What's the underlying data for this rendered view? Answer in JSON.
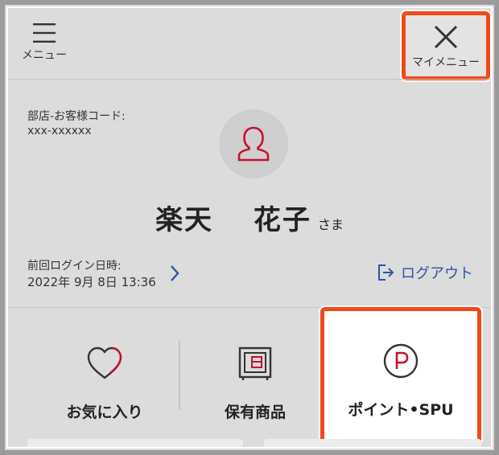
{
  "header": {
    "menu_label": "メニュー",
    "mymenu_label": "マイメニュー"
  },
  "member": {
    "code_label": "部店-お客様コード:",
    "code_value": "xxx-xxxxxx",
    "name": "楽天　 花子",
    "honorific": "さま",
    "last_login_label": "前回ログイン日時:",
    "last_login_value": "2022年 9月 8日 13:36",
    "logout_label": "ログアウト"
  },
  "tiles": [
    {
      "label": "お気に入り",
      "icon": "heart-icon"
    },
    {
      "label": "保有商品",
      "icon": "safe-icon"
    },
    {
      "label": "ポイント•SPU",
      "icon": "point-icon"
    }
  ],
  "colors": {
    "highlight": "#f04a1a",
    "accent_red": "#c8102e",
    "link_blue": "#2a55a6",
    "background": "#dcdcdc"
  }
}
